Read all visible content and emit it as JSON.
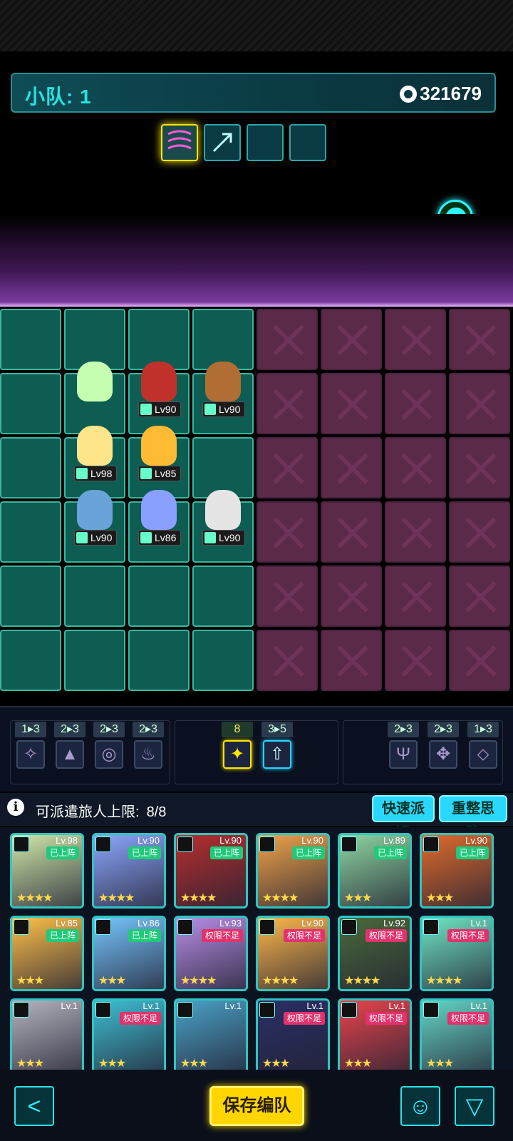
{
  "header": {
    "team_label": "小队: 1",
    "power_value": "321679",
    "power_icon": "power-icon"
  },
  "skill_slots": [
    {
      "name": "skill-slot-1",
      "icon": "wave-icon",
      "state": "active"
    },
    {
      "name": "skill-slot-2",
      "icon": "sparkle-arrow-icon",
      "state": "filled"
    },
    {
      "name": "skill-slot-3",
      "icon": "",
      "state": "empty"
    },
    {
      "name": "skill-slot-4",
      "icon": "",
      "state": "empty"
    }
  ],
  "board": {
    "units": [
      {
        "name": "unit-green-girl",
        "level": "",
        "color": "#c7ffb2"
      },
      {
        "name": "unit-robot",
        "level": "Lv90",
        "color": "#c0312b"
      },
      {
        "name": "unit-cat-boy",
        "level": "Lv90",
        "color": "#b06d34"
      },
      {
        "name": "unit-blonde-girl",
        "level": "Lv98",
        "color": "#ffe58a"
      },
      {
        "name": "unit-yellow-hat",
        "level": "Lv85",
        "color": "#ffbb33"
      },
      {
        "name": "unit-fox-girl",
        "level": "Lv90",
        "color": "#6aa3d9"
      },
      {
        "name": "unit-blue-girl",
        "level": "Lv86",
        "color": "#8aa0ff"
      },
      {
        "name": "unit-helmet-boy",
        "level": "Lv90",
        "color": "#e5e5e5"
      }
    ]
  },
  "synergies": {
    "left": [
      {
        "count": "1▸3",
        "icon": "✧"
      },
      {
        "count": "2▸3",
        "icon": "▲"
      },
      {
        "count": "2▸3",
        "icon": "◎"
      },
      {
        "count": "2▸3",
        "icon": "♨"
      }
    ],
    "middle": [
      {
        "count": "8",
        "icon": "✦",
        "state": "gold"
      },
      {
        "count": "3▸5",
        "icon": "⇧",
        "state": "blue"
      }
    ],
    "right": [
      {
        "count": "2▸3",
        "icon": "Ψ"
      },
      {
        "count": "2▸3",
        "icon": "✥"
      },
      {
        "count": "1▸3",
        "icon": "⬦"
      }
    ]
  },
  "roster": {
    "limit_label": "可派遣旅人上限:",
    "limit_value": "8/8",
    "quick_deploy": "快速派遣",
    "reorganize": "重整思路",
    "cards": [
      {
        "level": "Lv.98",
        "badge": "已上阵",
        "status": "on",
        "stars": "★★★★",
        "color": "#cfe7a8"
      },
      {
        "level": "Lv.90",
        "badge": "已上阵",
        "status": "on",
        "stars": "★★★★",
        "color": "#8ca7ff"
      },
      {
        "level": "Lv.90",
        "badge": "已上阵",
        "status": "on",
        "stars": "★★★★",
        "color": "#b72e2e"
      },
      {
        "level": "Lv.90",
        "badge": "已上阵",
        "status": "on",
        "stars": "★★★★",
        "color": "#f0a34a"
      },
      {
        "level": "Lv.89",
        "badge": "已上阵",
        "status": "on",
        "stars": "★★★",
        "color": "#8dd6a0"
      },
      {
        "level": "Lv.90",
        "badge": "已上阵",
        "status": "on",
        "stars": "★★★",
        "color": "#e06b2c"
      },
      {
        "level": "Lv.85",
        "badge": "已上阵",
        "status": "on",
        "stars": "★★★",
        "color": "#ffc04a"
      },
      {
        "level": "Lv.86",
        "badge": "已上阵",
        "status": "on",
        "stars": "★★★",
        "color": "#76c6ff"
      },
      {
        "level": "Lv.93",
        "badge": "权限不足",
        "status": "off",
        "stars": "★★★★",
        "color": "#b98ee8"
      },
      {
        "level": "Lv.90",
        "badge": "权限不足",
        "status": "off",
        "stars": "★★★★",
        "color": "#ffb84a"
      },
      {
        "level": "Lv.92",
        "badge": "权限不足",
        "status": "off",
        "stars": "★★★★",
        "color": "#4a6a3a"
      },
      {
        "level": "Lv.1",
        "badge": "权限不足",
        "status": "off",
        "stars": "★★★★",
        "color": "#6fe6c4"
      },
      {
        "level": "Lv.1",
        "badge": "",
        "status": "none",
        "stars": "★★★",
        "color": "#b5b5c0"
      },
      {
        "level": "Lv.1",
        "badge": "权限不足",
        "status": "off",
        "stars": "★★★",
        "color": "#3fbfd4"
      },
      {
        "level": "Lv.1",
        "badge": "",
        "status": "none",
        "stars": "★★★",
        "color": "#4aa2c7"
      },
      {
        "level": "Lv.1",
        "badge": "权限不足",
        "status": "off",
        "stars": "★★★",
        "color": "#2a2f66"
      },
      {
        "level": "Lv.1",
        "badge": "权限不足",
        "status": "off",
        "stars": "★★★",
        "color": "#e8444c"
      },
      {
        "level": "Lv.1",
        "badge": "权限不足",
        "status": "off",
        "stars": "★★★",
        "color": "#65d6c6"
      }
    ]
  },
  "bottom": {
    "back": "<",
    "save_label": "保存编队",
    "filter": "▽",
    "head": "☺"
  }
}
